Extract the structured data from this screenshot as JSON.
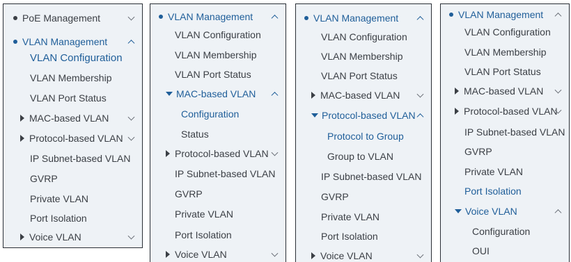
{
  "panel1": {
    "poe_management": "PoE Management",
    "vlan_management": "VLAN Management",
    "vlan_configuration": "VLAN Configuration",
    "vlan_membership": "VLAN Membership",
    "vlan_port_status": "VLAN Port Status",
    "mac_based_vlan": "MAC-based VLAN",
    "protocol_based_vlan": "Protocol-based VLAN",
    "ip_subnet_based_vlan": "IP Subnet-based VLAN",
    "gvrp": "GVRP",
    "private_vlan": "Private VLAN",
    "port_isolation": "Port Isolation",
    "voice_vlan": "Voice VLAN"
  },
  "panel2": {
    "vlan_management": "VLAN Management",
    "vlan_configuration": "VLAN Configuration",
    "vlan_membership": "VLAN Membership",
    "vlan_port_status": "VLAN Port Status",
    "mac_based_vlan": "MAC-based VLAN",
    "configuration": "Configuration",
    "status": "Status",
    "protocol_based_vlan": "Protocol-based VLAN",
    "ip_subnet_based_vlan": "IP Subnet-based VLAN",
    "gvrp": "GVRP",
    "private_vlan": "Private VLAN",
    "port_isolation": "Port Isolation",
    "voice_vlan": "Voice VLAN"
  },
  "panel3": {
    "vlan_management": "VLAN Management",
    "vlan_configuration": "VLAN Configuration",
    "vlan_membership": "VLAN Membership",
    "vlan_port_status": "VLAN Port Status",
    "mac_based_vlan": "MAC-based VLAN",
    "protocol_based_vlan": "Protocol-based VLAN",
    "protocol_to_group": "Protocol to Group",
    "group_to_vlan": "Group to VLAN",
    "ip_subnet_based_vlan": "IP Subnet-based VLAN",
    "gvrp": "GVRP",
    "private_vlan": "Private VLAN",
    "port_isolation": "Port Isolation",
    "voice_vlan": "Voice VLAN"
  },
  "panel4": {
    "vlan_management": "VLAN Management",
    "vlan_configuration": "VLAN Configuration",
    "vlan_membership": "VLAN Membership",
    "vlan_port_status": "VLAN Port Status",
    "mac_based_vlan": "MAC-based VLAN",
    "protocol_based_vlan": "Protocol-based VLAN",
    "ip_subnet_based_vlan": "IP Subnet-based VLAN",
    "gvrp": "GVRP",
    "private_vlan": "Private VLAN",
    "port_isolation": "Port Isolation",
    "voice_vlan": "Voice VLAN",
    "configuration": "Configuration",
    "oui": "OUI"
  },
  "colors": {
    "panel_bg": "#eef2f6",
    "text": "#3b3f45",
    "active_blue": "#1f5e99",
    "border": "#2a2f36"
  }
}
